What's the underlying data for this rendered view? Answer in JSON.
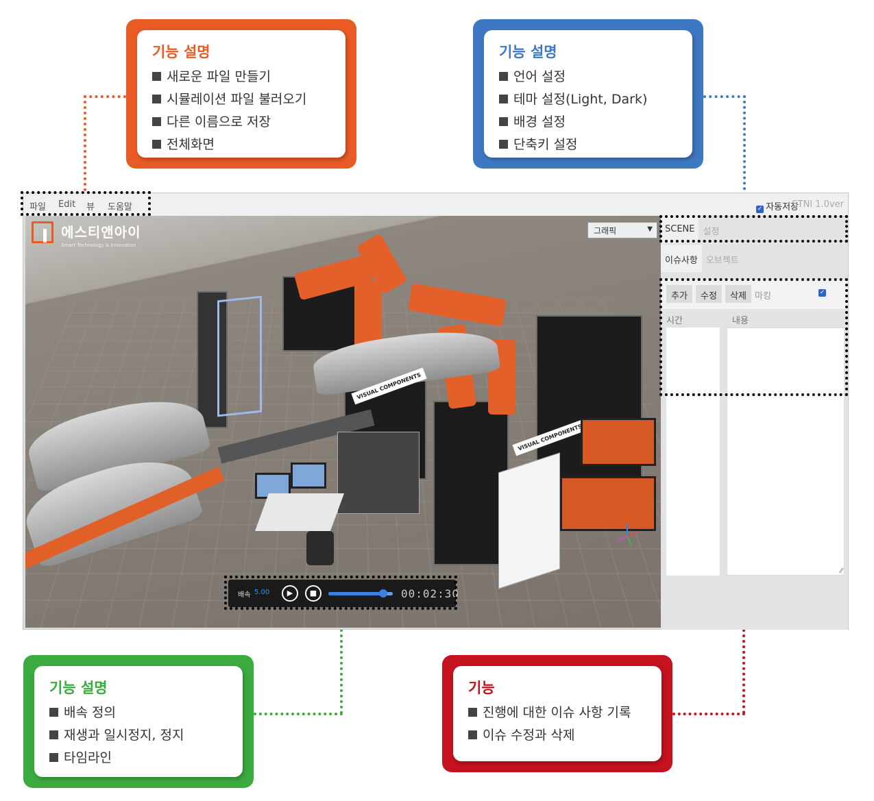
{
  "callouts": {
    "file": {
      "title": "기능 설명",
      "items": [
        "새로운 파일 만들기",
        "시뮬레이션 파일 불러오기",
        "다른 이름으로 저장",
        "전체화면"
      ],
      "color": "#e95a24"
    },
    "settings": {
      "title": "기능 설명",
      "items": [
        "언어 설정",
        "테마 설정(Light, Dark)",
        "배경 설정",
        "단축키 설정"
      ],
      "color": "#3f78c2"
    },
    "playback": {
      "title": "기능 설명",
      "items": [
        "배속 정의",
        "재생과 일시정지, 정지",
        "타임라인"
      ],
      "color": "#3bab3f"
    },
    "issues": {
      "title": "기능",
      "items": [
        "진행에 대한 이슈 사항 기록",
        "이슈 수정과 삭제"
      ],
      "color": "#c5121f"
    }
  },
  "app": {
    "menu": [
      "파일",
      "Edit",
      "뷰",
      "도움말"
    ],
    "autosave_label": "자동저장",
    "autosave_checked": true,
    "version": "STNI 1.0ver",
    "logo": {
      "name": "에스티앤아이",
      "tagline": "Smart Technology & Innovation"
    },
    "graphic_select": "그래픽",
    "scene_badges": [
      "VISUAL COMPONENTS",
      "VISUAL COMPONENTS"
    ],
    "playbar": {
      "speed_label": "배속",
      "speed_value": "5.00",
      "play_icon": "play-icon",
      "stop_icon": "stop-icon",
      "progress": 0.85,
      "time": "00:02:30"
    },
    "panel": {
      "top_tabs": [
        "SCENE",
        "설정"
      ],
      "sub_tabs": [
        "이슈사항",
        "오브젝트"
      ],
      "buttons": [
        "추가",
        "수정",
        "삭제"
      ],
      "marking_label": "마킹",
      "marking_checked": true,
      "col_time": "시간",
      "col_content": "내용"
    }
  }
}
